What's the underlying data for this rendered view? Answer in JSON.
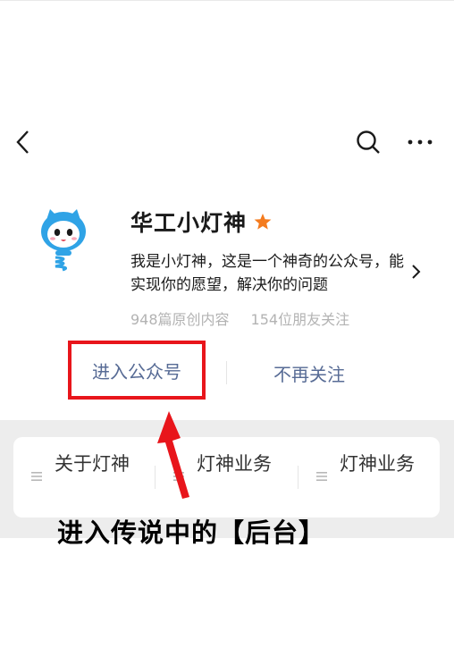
{
  "nav": {
    "back_icon": "chevron-left-icon",
    "search_icon": "search-icon",
    "more_icon": "more-horizontal-icon"
  },
  "account": {
    "name": "华工小灯神",
    "star_icon": "star-icon",
    "star_color": "#f47b1e",
    "description": "我是小灯神，这是一个神奇的公众号，能实现你的愿望，解决你的问题",
    "articles": "948篇原创内容",
    "friends": "154位朋友关注"
  },
  "actions": {
    "enter": "进入公众号",
    "unfollow": "不再关注"
  },
  "menu": [
    {
      "label": "关于灯神",
      "icon": "menu-lines-icon"
    },
    {
      "label": "灯神业务",
      "icon": "menu-lines-icon"
    },
    {
      "label": "灯神业务",
      "icon": "menu-lines-icon"
    }
  ],
  "annotation": {
    "text": "进入传说中的【后台】",
    "highlight_color": "#e8151b"
  },
  "colors": {
    "link": "#576b95",
    "muted": "#b3b3b3",
    "panel_bg": "#ededed"
  }
}
